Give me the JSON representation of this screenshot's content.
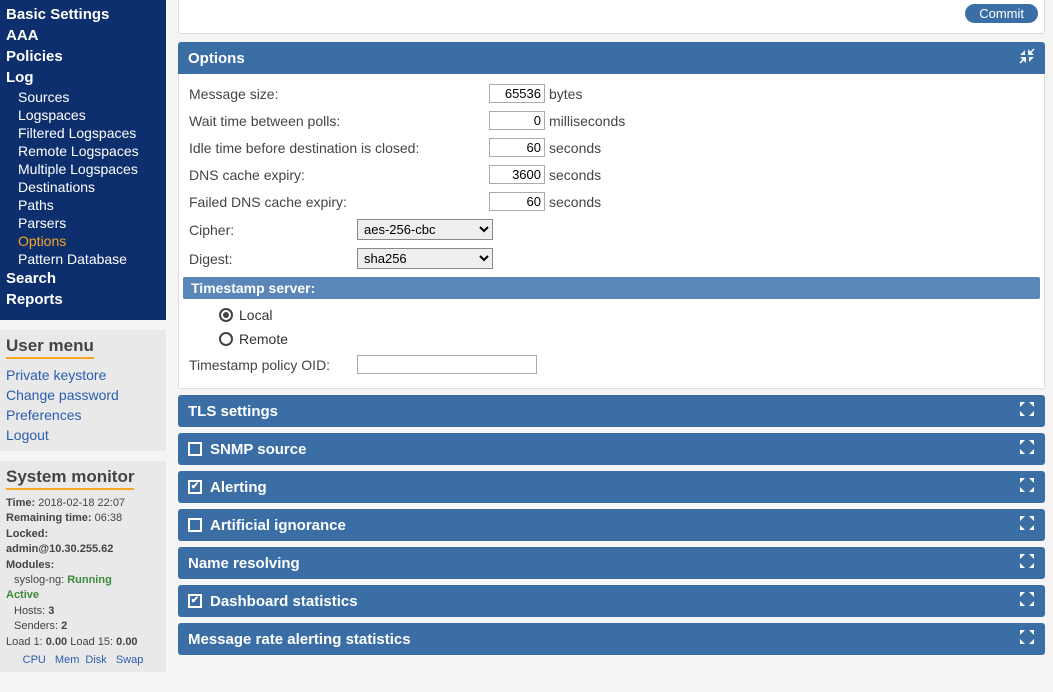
{
  "nav": {
    "basic": "Basic Settings",
    "aaa": "AAA",
    "policies": "Policies",
    "log": "Log",
    "log_items": {
      "sources": "Sources",
      "logspaces": "Logspaces",
      "filtered": "Filtered Logspaces",
      "remote": "Remote Logspaces",
      "multiple": "Multiple Logspaces",
      "destinations": "Destinations",
      "paths": "Paths",
      "parsers": "Parsers",
      "options": "Options",
      "pattern": "Pattern Database"
    },
    "search": "Search",
    "reports": "Reports"
  },
  "user_menu": {
    "title": "User menu",
    "keystore": "Private keystore",
    "changepw": "Change password",
    "prefs": "Preferences",
    "logout": "Logout"
  },
  "sysmon": {
    "title": "System monitor",
    "time_lbl": "Time:",
    "time_val": "2018-02-18 22:07",
    "remain_lbl": "Remaining time:",
    "remain_val": "06:38",
    "locked_lbl": "Locked:",
    "locked_val": "admin@10.30.255.62",
    "modules_lbl": "Modules:",
    "syslog_lbl": "syslog-ng:",
    "syslog_val": "Running",
    "active": "Active",
    "hosts_lbl": "Hosts:",
    "hosts_val": "3",
    "senders_lbl": "Senders:",
    "senders_val": "2",
    "load1_lbl": "Load 1:",
    "load1_val": "0.00",
    "load15_lbl": "Load 15:",
    "load15_val": "0.00",
    "tabs": {
      "cpu": "CPU",
      "mem": "Mem",
      "disk": "Disk",
      "swap": "Swap"
    }
  },
  "commit": "Commit",
  "panels": {
    "options": {
      "title": "Options",
      "msg_size_lbl": "Message size:",
      "msg_size_val": "65536",
      "msg_size_unit": "bytes",
      "wait_lbl": "Wait time between polls:",
      "wait_val": "0",
      "wait_unit": "milliseconds",
      "idle_lbl": "Idle time before destination is closed:",
      "idle_val": "60",
      "idle_unit": "seconds",
      "dns_lbl": "DNS cache expiry:",
      "dns_val": "3600",
      "dns_unit": "seconds",
      "fdns_lbl": "Failed DNS cache expiry:",
      "fdns_val": "60",
      "fdns_unit": "seconds",
      "cipher_lbl": "Cipher:",
      "cipher_val": "aes-256-cbc",
      "digest_lbl": "Digest:",
      "digest_val": "sha256",
      "ts_hdr": "Timestamp server:",
      "ts_local": "Local",
      "ts_remote": "Remote",
      "ts_oid_lbl": "Timestamp policy OID:",
      "ts_oid_val": ""
    },
    "tls": "TLS settings",
    "snmp": "SNMP source",
    "alerting": "Alerting",
    "artificial": "Artificial ignorance",
    "name_res": "Name resolving",
    "dash": "Dashboard statistics",
    "msg_rate": "Message rate alerting statistics"
  },
  "checkbox_state": {
    "snmp": false,
    "alerting": true,
    "artificial": false,
    "dash": true
  }
}
